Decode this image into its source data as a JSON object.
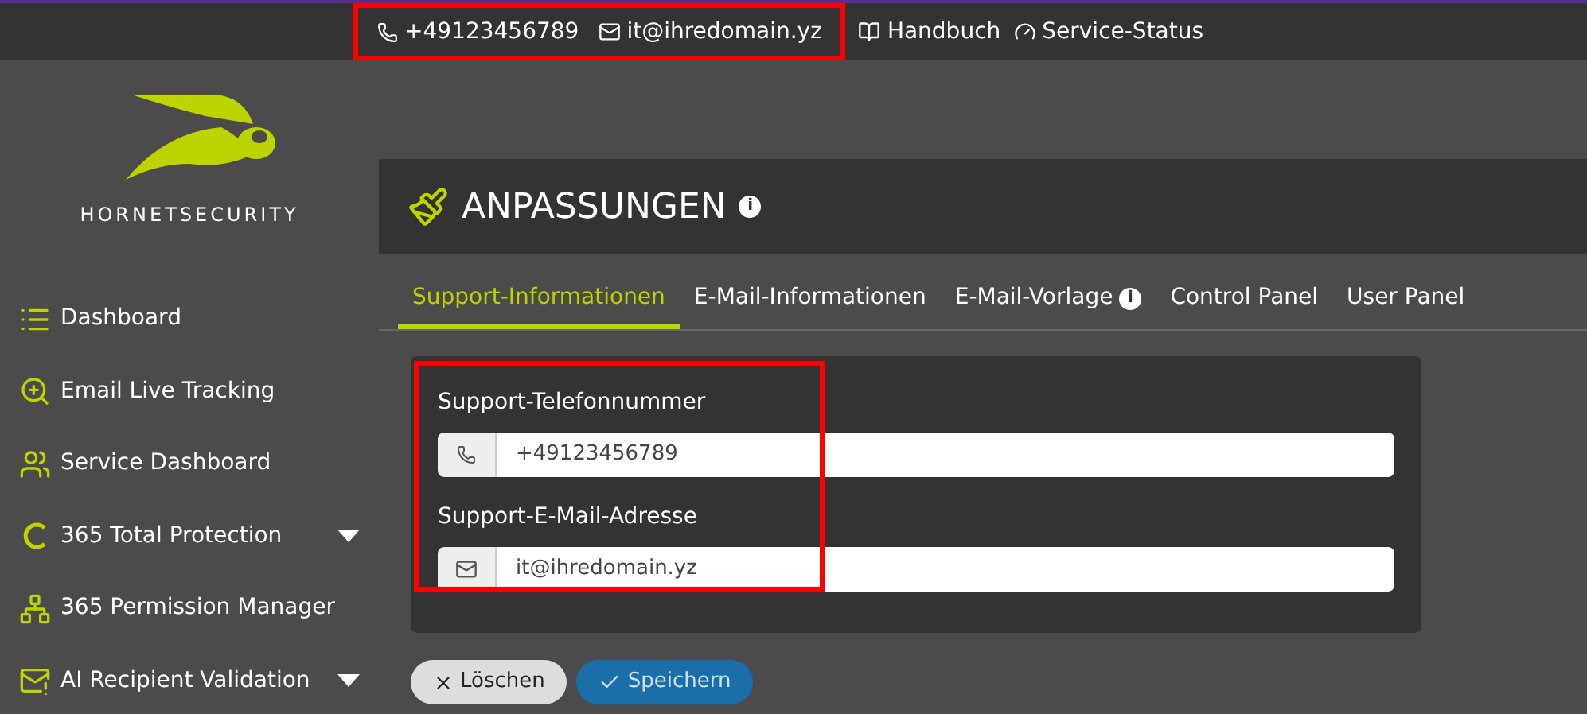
{
  "topbar": {
    "contacts_highlighted": true,
    "contacts": [
      {
        "text": "+49123456789"
      },
      {
        "text": "it@ihredomain.yz"
      }
    ],
    "links": [
      {
        "text": "Handbuch"
      },
      {
        "text": "Service-Status"
      }
    ]
  },
  "logo": {
    "text": "HORNETSECURITY"
  },
  "sidebar": {
    "items": [
      {
        "label": "Dashboard",
        "has_submenu": false
      },
      {
        "label": "Email Live Tracking",
        "has_submenu": false
      },
      {
        "label": "Service Dashboard",
        "has_submenu": false
      },
      {
        "label": "365 Total Protection",
        "has_submenu": true
      },
      {
        "label": "365 Permission Manager",
        "has_submenu": false
      },
      {
        "label": "AI Recipient Validation",
        "has_submenu": true
      }
    ]
  },
  "page": {
    "title": "ANPASSUNGEN",
    "title_info": "i"
  },
  "tabs": [
    {
      "label": "Support-Informationen",
      "selected": true
    },
    {
      "label": "E-Mail-Informationen",
      "selected": false
    },
    {
      "label": "E-Mail-Vorlage",
      "selected": false,
      "info": "i"
    },
    {
      "label": "Control Panel",
      "selected": false
    },
    {
      "label": "User Panel",
      "selected": false
    }
  ],
  "form": {
    "highlighted": true,
    "fields": [
      {
        "label": "Support-Telefonnummer",
        "kind": "phone",
        "value": "+49123456789"
      },
      {
        "label": "Support-E-Mail-Adresse",
        "kind": "email",
        "value": "it@ihredomain.yz"
      }
    ]
  },
  "buttons": [
    {
      "label": "Löschen",
      "kind": "clear"
    },
    {
      "label": "Speichern",
      "kind": "save"
    }
  ]
}
